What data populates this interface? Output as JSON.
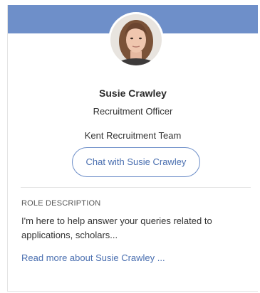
{
  "profile": {
    "name": "Susie Crawley",
    "role": "Recruitment Officer",
    "team": "Kent Recruitment Team",
    "chat_button_label": "Chat with Susie Crawley",
    "avatar_alt": "Susie Crawley"
  },
  "role_description": {
    "label": "ROLE DESCRIPTION",
    "text": "I'm here to help answer your queries related to applications, scholars...",
    "read_more_label": "Read more about Susie Crawley ..."
  },
  "colors": {
    "banner": "#6e8fc9",
    "accent": "#4a6fb0",
    "text": "#333333",
    "divider": "#e3e3e3"
  }
}
